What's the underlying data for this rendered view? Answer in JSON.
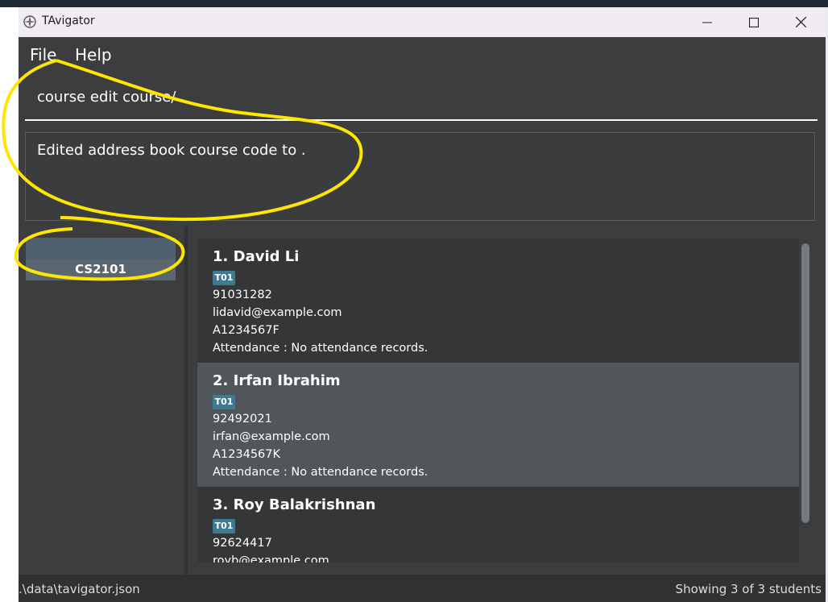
{
  "window": {
    "title": "TAvigator",
    "icon": "compass-icon"
  },
  "menu": [
    "File",
    "Help"
  ],
  "command": {
    "value": "course edit course/"
  },
  "result": {
    "text": "Edited address book course code to ."
  },
  "courses": [
    {
      "code": "CS2101"
    }
  ],
  "students": [
    {
      "index": "1.",
      "name": "David Li",
      "tag": "T01",
      "phone": "91031282",
      "email": "lidavid@example.com",
      "id": "A1234567F",
      "attendance": "Attendance : No attendance records."
    },
    {
      "index": "2.",
      "name": "Irfan Ibrahim",
      "tag": "T01",
      "phone": "92492021",
      "email": "irfan@example.com",
      "id": "A1234567K",
      "attendance": "Attendance : No attendance records."
    },
    {
      "index": "3.",
      "name": "Roy Balakrishnan",
      "tag": "T01",
      "phone": "92624417",
      "email": "royb@example.com",
      "id": "",
      "attendance": ""
    }
  ],
  "status": {
    "path": ".\\data\\tavigator.json",
    "count": "Showing 3 of 3 students"
  },
  "colors": {
    "window_bg": "#3b3d3f",
    "card_dark": "#343638",
    "card_selected": "#505659",
    "tag": "#3e7b91",
    "annotation": "#ffe600"
  }
}
